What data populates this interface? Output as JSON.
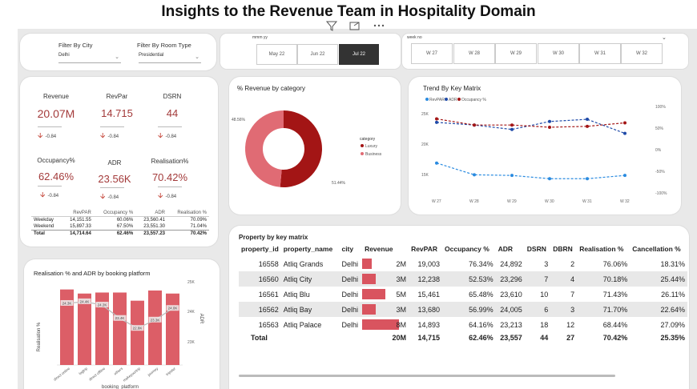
{
  "title": "Insights to the Revenue Team in Hospitality Domain",
  "toolbar": {
    "icons": [
      "filter-icon",
      "focus-mode-icon",
      "more-options-icon"
    ]
  },
  "filters": {
    "city_label": "Filter By City",
    "city_value": "Delhi",
    "room_label": "Filter By Room Type",
    "room_value": "Presidential"
  },
  "month_slicer": {
    "title": "mmm yy",
    "options": [
      "May 22",
      "Jun 22",
      "Jul 22"
    ],
    "selected": "Jul 22"
  },
  "week_slicer": {
    "title": "week no",
    "options": [
      "W 27",
      "W 28",
      "W 29",
      "W 30",
      "W 31",
      "W 32"
    ]
  },
  "kpis": {
    "revenue": {
      "label": "Revenue",
      "value": "20.07M",
      "delta": "-0.84"
    },
    "revpar": {
      "label": "RevPar",
      "value": "14.715",
      "delta": "-0.84"
    },
    "dsrn": {
      "label": "DSRN",
      "value": "44",
      "delta": "-0.84"
    },
    "occupancy": {
      "label": "Occupancy%",
      "value": "62.46%",
      "delta": "-0.84"
    },
    "adr": {
      "label": "ADR",
      "value": "23.56K",
      "delta": "-0.84"
    },
    "realisation": {
      "label": "Realisation%",
      "value": "70.42%",
      "delta": "-0.84"
    }
  },
  "mini_table": {
    "headers": [
      "",
      "RevPAR",
      "Occupancy %",
      "ADR",
      "Realisation %"
    ],
    "rows": [
      [
        "Weekday",
        "14,151.55",
        "60.06%",
        "23,560.41",
        "70.09%"
      ],
      [
        "Weekend",
        "15,897.33",
        "67.50%",
        "23,551.30",
        "71.04%"
      ],
      [
        "Total",
        "14,714.64",
        "62.46%",
        "23,557.23",
        "70.42%"
      ]
    ]
  },
  "donut": {
    "title": "% Revenue by category",
    "legend_title": "category",
    "slices": [
      {
        "name": "Luxury",
        "pct": 51.44,
        "label": "51.44%",
        "color": "#a31515"
      },
      {
        "name": "Business",
        "pct": 48.56,
        "label": "48.56%",
        "color": "#e06b74"
      }
    ]
  },
  "trend": {
    "title": "Trend By Key Matrix",
    "legend": [
      {
        "name": "RevPAR",
        "color": "#2a8be0"
      },
      {
        "name": "ADR",
        "color": "#1f4aa8"
      },
      {
        "name": "Occupancy %",
        "color": "#a31515"
      }
    ],
    "y_left_ticks": [
      "25K",
      "20K",
      "15K"
    ],
    "y_right_ticks": [
      "100%",
      "50%",
      "0%",
      "-50%",
      "-100%"
    ],
    "x": [
      "W 27",
      "W 28",
      "W 29",
      "W 30",
      "W 31",
      "W 32"
    ]
  },
  "property_table": {
    "title": "Property by key matrix",
    "headers": [
      "property_id",
      "property_name",
      "city",
      "Revenue",
      "RevPAR",
      "Occupancy %",
      "ADR",
      "DSRN",
      "DBRN",
      "Realisation %",
      "Cancellation %"
    ],
    "rows": [
      {
        "id": "16558",
        "name": "Atliq Grands",
        "city": "Delhi",
        "rev": "2M",
        "rev_value": 2,
        "revpar": "19,003",
        "occ": "76.34%",
        "adr": "24,892",
        "dsrn": "3",
        "dbrn": "2",
        "real": "76.06%",
        "canc": "18.31%"
      },
      {
        "id": "16560",
        "name": "Atliq City",
        "city": "Delhi",
        "rev": "3M",
        "rev_value": 3,
        "revpar": "12,238",
        "occ": "52.53%",
        "adr": "23,296",
        "dsrn": "7",
        "dbrn": "4",
        "real": "70.18%",
        "canc": "25.44%"
      },
      {
        "id": "16561",
        "name": "Atliq Blu",
        "city": "Delhi",
        "rev": "5M",
        "rev_value": 5,
        "revpar": "15,461",
        "occ": "65.48%",
        "adr": "23,610",
        "dsrn": "10",
        "dbrn": "7",
        "real": "71.43%",
        "canc": "26.11%"
      },
      {
        "id": "16562",
        "name": "Atliq Bay",
        "city": "Delhi",
        "rev": "3M",
        "rev_value": 3,
        "revpar": "13,680",
        "occ": "56.99%",
        "adr": "24,005",
        "dsrn": "6",
        "dbrn": "3",
        "real": "71.70%",
        "canc": "22.64%"
      },
      {
        "id": "16563",
        "name": "Atliq Palace",
        "city": "Delhi",
        "rev": "8M",
        "rev_value": 8,
        "revpar": "14,893",
        "occ": "64.16%",
        "adr": "23,213",
        "dsrn": "18",
        "dbrn": "12",
        "real": "68.44%",
        "canc": "27.09%"
      }
    ],
    "total": {
      "label": "Total",
      "rev": "20M",
      "revpar": "14,715",
      "occ": "62.46%",
      "adr": "23,557",
      "dsrn": "44",
      "dbrn": "27",
      "real": "70.42%",
      "canc": "25.35%"
    }
  },
  "platform_chart": {
    "title": "Realisation % and ADR by booking platform",
    "xlabel": "booking_platform",
    "ylabel_left": "Realisation %",
    "ylabel_right": "ADR",
    "right_ticks": [
      "25K",
      "24K",
      "23K"
    ]
  },
  "chart_data": [
    {
      "type": "line",
      "title": "Trend By Key Matrix",
      "x": [
        "W 27",
        "W 28",
        "W 29",
        "W 30",
        "W 31",
        "W 32"
      ],
      "series": [
        {
          "name": "RevPAR",
          "axis": "left",
          "values": [
            17200,
            15400,
            15300,
            14800,
            14800,
            15300
          ],
          "color": "#2a8be0"
        },
        {
          "name": "ADR",
          "axis": "right",
          "values": [
            62,
            56,
            46,
            64,
            69,
            37
          ],
          "color": "#1f4aa8"
        },
        {
          "name": "Occupancy %",
          "axis": "right",
          "values": [
            70,
            56,
            56,
            51,
            53,
            61
          ],
          "color": "#a31515"
        }
      ],
      "ylim_left": [
        12500,
        26000
      ],
      "ylim_right": [
        -100,
        100
      ]
    },
    {
      "type": "bar",
      "title": "Realisation % and ADR by booking platform",
      "categories": [
        "direct online",
        "logtrip",
        "direct offline",
        "others",
        "makeyourtrip",
        "journey",
        "tripster"
      ],
      "bar_series": {
        "name": "Realisation %",
        "values": [
          74,
          70,
          71,
          71,
          63,
          73,
          70
        ]
      },
      "line_series": {
        "name": "ADR",
        "values": [
          24300,
          24400,
          24200,
          23400,
          22800,
          23300,
          24000
        ],
        "labels": [
          "24.3K",
          "24.4K",
          "24.2K",
          "23.4K",
          "22.8K",
          "23.3K",
          "24.0K"
        ]
      },
      "ylim_right": [
        20600,
        25500
      ]
    }
  ]
}
